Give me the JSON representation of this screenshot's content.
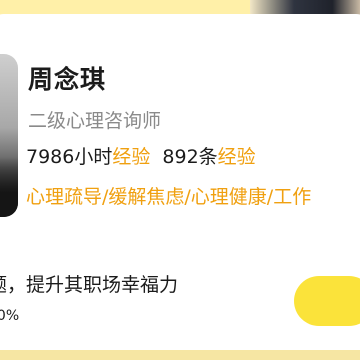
{
  "counselor": {
    "name": "周念琪",
    "title": "二级心理咨询师",
    "hours_value": "7986",
    "hours_label_unit": "小时",
    "hours_label": "经验",
    "cases_value": "892",
    "cases_label_unit": "条",
    "cases_label": "经验",
    "tags": "心理疏导/缓解焦虑/心理健康/工作"
  },
  "promo": {
    "slogan": "题，提升其职场幸福力",
    "percent": "00%"
  },
  "colors": {
    "accent": "#f0a010",
    "button": "#fbe33a",
    "background": "#f6e6a3"
  }
}
